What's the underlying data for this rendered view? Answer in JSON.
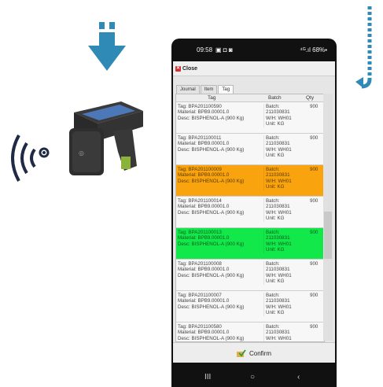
{
  "status_bar": {
    "time": "09:58",
    "icons": "▣ ◘ ◙",
    "right": "⁴ᴳ.ıl 68%▪"
  },
  "app": {
    "close_label": "Close",
    "close_icon": "close-icon"
  },
  "tabs": [
    {
      "label": "Journal"
    },
    {
      "label": "Item"
    },
    {
      "label": "Tag"
    }
  ],
  "columns": {
    "tag": "Tag",
    "batch": "Batch",
    "qty": "Qty"
  },
  "rows": [
    {
      "tag": "Tag: BPA201100590",
      "material": "Material: BPB9.00001.0",
      "desc": "Desc: BISPHENOL-A (900 Kg)",
      "batch_label": "Batch:",
      "batch": "211030831",
      "wh": "W/H: WH01",
      "unit": "Unit: KG",
      "qty": "900",
      "status": "normal"
    },
    {
      "tag": "Tag: BPA201100011",
      "material": "Material: BPB9.00001.0",
      "desc": "Desc: BISPHENOL-A (900 Kg)",
      "batch_label": "Batch:",
      "batch": "211030831",
      "wh": "W/H: WH01",
      "unit": "Unit: KG",
      "qty": "900",
      "status": "normal"
    },
    {
      "tag": "Tag: BPA201100009",
      "material": "Material: BPB9.00001.0",
      "desc": "Desc: BISPHENOL-A (900 Kg)",
      "batch_label": "Batch:",
      "batch": "211030831",
      "wh": "W/H: WH01",
      "unit": "Unit: KG",
      "qty": "900",
      "status": "orange"
    },
    {
      "tag": "Tag: BPA201100014",
      "material": "Material: BPB9.00001.0",
      "desc": "Desc: BISPHENOL-A (900 Kg)",
      "batch_label": "Batch:",
      "batch": "211030831",
      "wh": "W/H: WH01",
      "unit": "Unit: KG",
      "qty": "900",
      "status": "normal"
    },
    {
      "tag": "Tag: BPA201100013",
      "material": "Material: BPB9.00001.0",
      "desc": "Desc: BISPHENOL-A (900 Kg)",
      "batch_label": "Batch:",
      "batch": "211030831",
      "wh": "W/H: WH01",
      "unit": "Unit: KG",
      "qty": "900",
      "status": "green"
    },
    {
      "tag": "Tag: BPA201100008",
      "material": "Material: BPB9.00001.0",
      "desc": "Desc: BISPHENOL-A (900 Kg)",
      "batch_label": "Batch:",
      "batch": "211030831",
      "wh": "W/H: WH01",
      "unit": "Unit: KG",
      "qty": "900",
      "status": "normal"
    },
    {
      "tag": "Tag: BPA201100007",
      "material": "Material: BPB9.00001.0",
      "desc": "Desc: BISPHENOL-A (900 Kg)",
      "batch_label": "Batch:",
      "batch": "211030831",
      "wh": "W/H: WH01",
      "unit": "Unit: KG",
      "qty": "900",
      "status": "normal"
    },
    {
      "tag": "Tag: BPA201100580",
      "material": "Material: BPB9.00001.0",
      "desc": "Desc: BISPHENOL-A (900 Kg)",
      "batch_label": "Batch:",
      "batch": "211030831",
      "wh": "W/H: WH01",
      "unit": "Unit: KG",
      "qty": "900",
      "status": "normal"
    }
  ],
  "confirm": {
    "label": "Confirm",
    "icon": "check-icon"
  },
  "nav": {
    "recents": "III",
    "home": "○",
    "back": "‹"
  },
  "colors": {
    "accent_arrow": "#2f8ab5",
    "row_highlight_orange": "#f9a40f",
    "row_highlight_green": "#12e84a"
  }
}
